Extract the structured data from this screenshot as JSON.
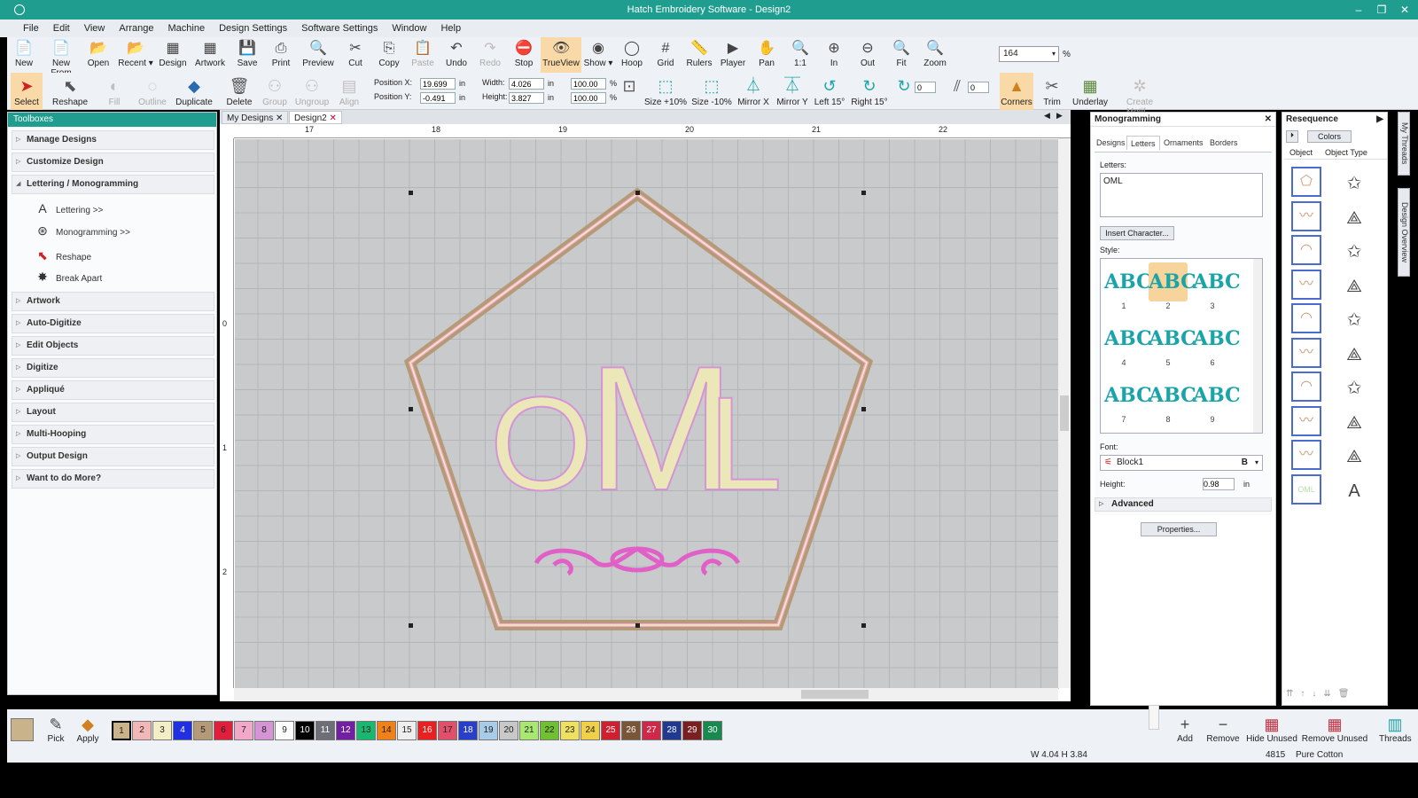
{
  "window": {
    "title": "Hatch Embroidery Software - Design2",
    "minimize": "–",
    "restore": "❐",
    "close": "✕"
  },
  "menu": [
    "File",
    "Edit",
    "View",
    "Arrange",
    "Machine",
    "Design Settings",
    "Software Settings",
    "Window",
    "Help"
  ],
  "toolbar1": [
    {
      "label": "New",
      "icon": "📄"
    },
    {
      "label": "New From",
      "icon": "📄"
    },
    {
      "label": "Open",
      "icon": "📂"
    },
    {
      "label": "Recent ▾",
      "icon": "📂"
    },
    {
      "label": "Design",
      "icon": "▦"
    },
    {
      "label": "Artwork",
      "icon": "▦"
    },
    {
      "label": "Save",
      "icon": "💾"
    },
    {
      "label": "Print",
      "icon": "⎙"
    },
    {
      "label": "Preview",
      "icon": "🔍"
    },
    {
      "label": "Cut",
      "icon": "✂"
    },
    {
      "label": "Copy",
      "icon": "⎘"
    },
    {
      "label": "Paste",
      "icon": "📋",
      "disabled": true
    },
    {
      "label": "Undo",
      "icon": "↶"
    },
    {
      "label": "Redo",
      "icon": "↷",
      "disabled": true
    },
    {
      "label": "Stop",
      "icon": "⛔"
    },
    {
      "label": "TrueView",
      "icon": "👁",
      "active": true
    },
    {
      "label": "Show ▾",
      "icon": "◉"
    },
    {
      "label": "Hoop",
      "icon": "◯"
    },
    {
      "label": "Grid",
      "icon": "#"
    },
    {
      "label": "Rulers",
      "icon": "📏"
    },
    {
      "label": "Player",
      "icon": "▶"
    },
    {
      "label": "Pan",
      "icon": "✋"
    },
    {
      "label": "1:1",
      "icon": "🔍"
    },
    {
      "label": "In",
      "icon": "⊕"
    },
    {
      "label": "Out",
      "icon": "⊖"
    },
    {
      "label": "Fit",
      "icon": "🔍"
    },
    {
      "label": "Zoom",
      "icon": "🔍"
    }
  ],
  "zoom": {
    "value": "164",
    "unit": "%"
  },
  "toolbar2": {
    "select": "Select",
    "reshape": "Reshape",
    "fill": "Fill",
    "outline": "Outline",
    "duplicate": "Duplicate",
    "delete": "Delete",
    "group": "Group",
    "ungroup": "Ungroup",
    "align": "Align",
    "pos_x_label": "Position X:",
    "pos_x": "19.699",
    "pos_y_label": "Position Y:",
    "pos_y": "-0.491",
    "width_label": "Width:",
    "width": "4.026",
    "height_label": "Height:",
    "height": "3.827",
    "unit": "in",
    "scale_w": "100.00",
    "scale_h": "100.00",
    "pct": "%",
    "size_up": "Size +10%",
    "size_down": "Size -10%",
    "mirror_x": "Mirror X",
    "mirror_y": "Mirror Y",
    "left15": "Left 15°",
    "right15": "Right 15°",
    "rotate": "0",
    "slant": "0",
    "corners": "Corners",
    "trim": "Trim",
    "underlay": "Underlay",
    "create_motif": "Create Motif..."
  },
  "toolboxes": {
    "title": "Toolboxes",
    "sections": [
      "Manage Designs",
      "Customize Design",
      "Lettering / Monogramming",
      "Artwork",
      "Auto-Digitize",
      "Edit Objects",
      "Digitize",
      "Appliqué",
      "Layout",
      "Multi-Hooping",
      "Output Design",
      "Want to do More?"
    ],
    "sub": [
      "Lettering >>",
      "Monogramming >>",
      "Reshape",
      "Break Apart"
    ]
  },
  "doctabs": [
    "My Designs",
    "Design2"
  ],
  "ruler": {
    "h": [
      "17",
      "18",
      "19",
      "20",
      "21",
      "22"
    ],
    "v": [
      "0",
      "1",
      "2"
    ]
  },
  "canvas": {
    "monogram": "OML"
  },
  "monogramming": {
    "title": "Monogramming",
    "tabs": [
      "Designs",
      "Letters",
      "Ornaments",
      "Borders"
    ],
    "letters_label": "Letters:",
    "letters": "OML",
    "insert": "Insert Character...",
    "style_label": "Style:",
    "styles": [
      "1",
      "2",
      "3",
      "4",
      "5",
      "6",
      "7",
      "8",
      "9"
    ],
    "font_label": "Font:",
    "font": "Block1",
    "height_label": "Height:",
    "height": "0.98",
    "unit": "in",
    "advanced": "Advanced",
    "properties": "Properties..."
  },
  "resequence": {
    "title": "Resequence",
    "tab": "Colors",
    "col1": "Object",
    "col2": "Object Type"
  },
  "sidetabs": [
    "My Threads",
    "Design Overview"
  ],
  "bottom": {
    "pick": "Pick",
    "apply": "Apply",
    "swatches": [
      {
        "n": "1",
        "c": "#c9b38a"
      },
      {
        "n": "2",
        "c": "#f2b8b8"
      },
      {
        "n": "3",
        "c": "#f3eec6"
      },
      {
        "n": "4",
        "c": "#2030e0"
      },
      {
        "n": "5",
        "c": "#b59a77"
      },
      {
        "n": "6",
        "c": "#e0203a"
      },
      {
        "n": "7",
        "c": "#f2a8c8"
      },
      {
        "n": "8",
        "c": "#d494d6"
      },
      {
        "n": "9",
        "c": "#ffffff"
      },
      {
        "n": "10",
        "c": "#000000"
      },
      {
        "n": "11",
        "c": "#6e6e78"
      },
      {
        "n": "12",
        "c": "#7020a0"
      },
      {
        "n": "13",
        "c": "#18b870"
      },
      {
        "n": "14",
        "c": "#f08018"
      },
      {
        "n": "15",
        "c": "#eeeeee"
      },
      {
        "n": "16",
        "c": "#e82020"
      },
      {
        "n": "17",
        "c": "#e0506a"
      },
      {
        "n": "18",
        "c": "#2840c8"
      },
      {
        "n": "19",
        "c": "#a8cce8"
      },
      {
        "n": "20",
        "c": "#c8c8c8"
      },
      {
        "n": "21",
        "c": "#a8e870"
      },
      {
        "n": "22",
        "c": "#70c030"
      },
      {
        "n": "23",
        "c": "#f0e060"
      },
      {
        "n": "24",
        "c": "#f0d048"
      },
      {
        "n": "25",
        "c": "#d02030"
      },
      {
        "n": "26",
        "c": "#7a5638"
      },
      {
        "n": "27",
        "c": "#d02848"
      },
      {
        "n": "28",
        "c": "#203a90"
      },
      {
        "n": "29",
        "c": "#7a2020"
      },
      {
        "n": "30",
        "c": "#188a50"
      }
    ],
    "add": "Add",
    "remove": "Remove",
    "hide_unused": "Hide Unused",
    "remove_unused": "Remove Unused",
    "threads": "Threads"
  },
  "status": {
    "size": "W 4.04 H 3.84",
    "thread_no": "4815",
    "thread_name": "Pure Cotton"
  }
}
